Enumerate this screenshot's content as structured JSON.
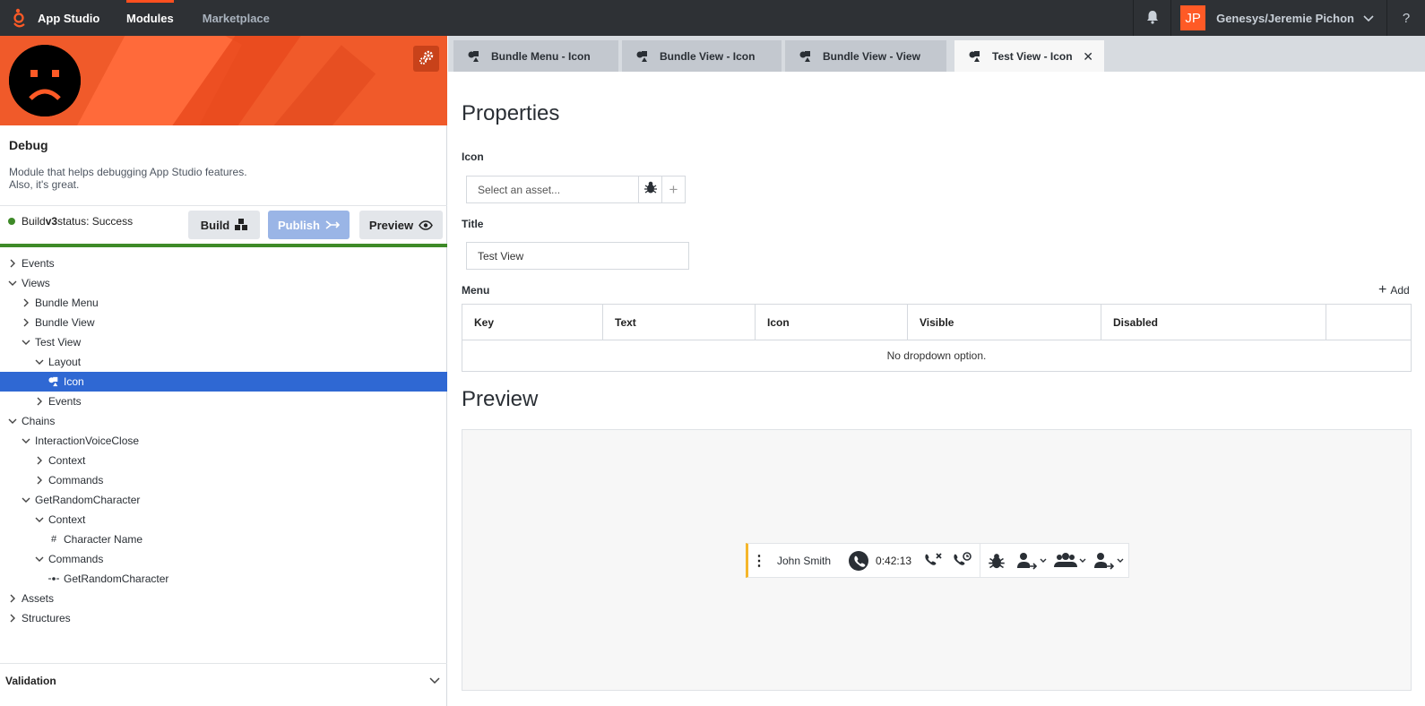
{
  "topbar": {
    "app_name": "App Studio",
    "nav": [
      "Modules",
      "Marketplace"
    ],
    "user_initials": "JP",
    "user_name": "Genesys/Jeremie Pichon",
    "help": "?"
  },
  "module": {
    "title": "Debug",
    "description_line1": "Module that helps debugging App Studio features.",
    "description_line2": "Also, it's great.",
    "status_prefix": "Build ",
    "status_version": "v3",
    "status_suffix": " status: Success",
    "status_color": "#3e8a28",
    "buttons": {
      "build": "Build",
      "publish": "Publish",
      "preview": "Preview"
    }
  },
  "tree": [
    {
      "label": "Events",
      "depth": 0,
      "state": "collapsed"
    },
    {
      "label": "Views",
      "depth": 0,
      "state": "expanded"
    },
    {
      "label": "Bundle Menu",
      "depth": 1,
      "state": "collapsed"
    },
    {
      "label": "Bundle View",
      "depth": 1,
      "state": "collapsed"
    },
    {
      "label": "Test View",
      "depth": 1,
      "state": "expanded"
    },
    {
      "label": "Layout",
      "depth": 2,
      "state": "expanded"
    },
    {
      "label": "Icon",
      "depth": 3,
      "state": "leaf-icon",
      "selected": true
    },
    {
      "label": "Events",
      "depth": 2,
      "state": "collapsed"
    },
    {
      "label": "Chains",
      "depth": 0,
      "state": "expanded"
    },
    {
      "label": "InteractionVoiceClose",
      "depth": 1,
      "state": "expanded"
    },
    {
      "label": "Context",
      "depth": 2,
      "state": "collapsed"
    },
    {
      "label": "Commands",
      "depth": 2,
      "state": "collapsed"
    },
    {
      "label": "GetRandomCharacter",
      "depth": 1,
      "state": "expanded"
    },
    {
      "label": "Context",
      "depth": 2,
      "state": "expanded"
    },
    {
      "label": "Character Name",
      "depth": 3,
      "state": "leaf-hash"
    },
    {
      "label": "Commands",
      "depth": 2,
      "state": "expanded"
    },
    {
      "label": "GetRandomCharacter",
      "depth": 3,
      "state": "leaf-cmd"
    },
    {
      "label": "Assets",
      "depth": 0,
      "state": "collapsed"
    },
    {
      "label": "Structures",
      "depth": 0,
      "state": "collapsed"
    }
  ],
  "validation": {
    "label": "Validation"
  },
  "tabs": [
    {
      "label": "Bundle Menu - Icon",
      "active": false
    },
    {
      "label": "Bundle View - Icon",
      "active": false
    },
    {
      "label": "Bundle View - View",
      "active": false
    },
    {
      "label": "Test View - Icon",
      "active": true
    }
  ],
  "properties": {
    "heading": "Properties",
    "icon_label": "Icon",
    "icon_placeholder": "Select an asset...",
    "title_label": "Title",
    "title_value": "Test View",
    "menu_label": "Menu",
    "add_label": "Add",
    "columns": [
      "Key",
      "Text",
      "Icon",
      "Visible",
      "Disabled",
      ""
    ],
    "empty_text": "No dropdown option."
  },
  "preview": {
    "heading": "Preview",
    "caller": "John Smith",
    "timer": "0:42:13",
    "accent": "#f5b62a"
  }
}
